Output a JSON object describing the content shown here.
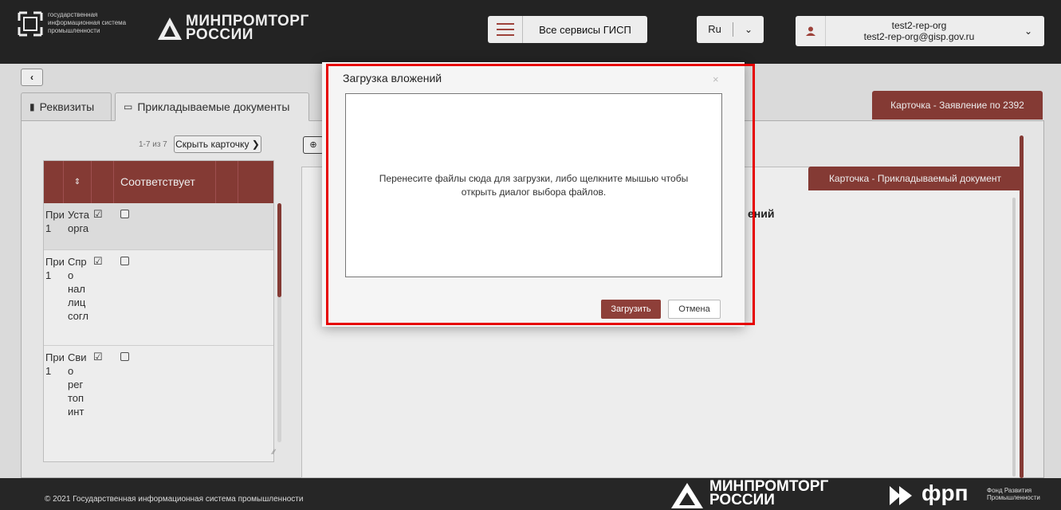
{
  "header": {
    "gisp_lines": [
      "государственная",
      "информационная система",
      "промышленности"
    ],
    "ministry_lines": [
      "МИНПРОМТОРГ",
      "РОССИИ"
    ],
    "services_label": "Все сервисы ГИСП",
    "lang": "Ru",
    "user_name": "test2-rep-org",
    "user_email": "test2-rep-org@gisp.gov.ru",
    "accent": "#8e3f39"
  },
  "nav": {
    "back": "‹"
  },
  "tabs": [
    {
      "label": "Реквизиты",
      "icon": "book-icon"
    },
    {
      "label": "Прикладываемые документы",
      "icon": "inbox-icon"
    }
  ],
  "card_tab": "Карточка - Заявление по 2392",
  "list": {
    "counter": "1-7 из 7",
    "hide_card": "Скрыть карточку",
    "column_sort": "⇕",
    "column_match": "Соответствует",
    "rows": [
      {
        "p1": "При",
        "p2": "1",
        "d": [
          "Уста",
          "орга"
        ]
      },
      {
        "p1": "При",
        "p2": "1",
        "d": [
          "Спр",
          "о",
          "нал",
          "лиц",
          "согл"
        ]
      },
      {
        "p1": "При",
        "p2": "1",
        "d": [
          "Сви",
          "о",
          "рег",
          "топ",
          "инт"
        ]
      }
    ]
  },
  "detail": {
    "card_tab": "Карточка - Прикладываемый документ",
    "fragment": "ений"
  },
  "modal": {
    "title": "Загрузка вложений",
    "close": "×",
    "drop_line1": "Перенесите файлы сюда для загрузки, либо щелкните мышью чтобы",
    "drop_line2": "открыть диалог выбора файлов.",
    "upload": "Загрузить",
    "cancel": "Отмена"
  },
  "footer": {
    "copyright": "© 2021 Государственная информационная система промышленности",
    "ministry_lines": [
      "МИНПРОМТОРГ",
      "РОССИИ"
    ],
    "frp": "фрп",
    "frp_sub": [
      "Фонд Развития",
      "Промышленности"
    ]
  }
}
